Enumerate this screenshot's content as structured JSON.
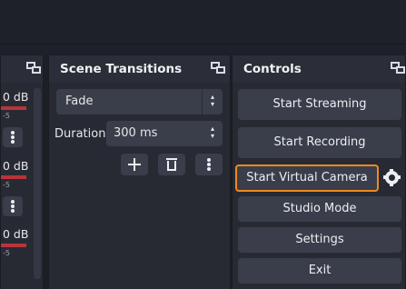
{
  "mixer": {
    "levels": [
      "0 dB",
      "0 dB",
      "0 dB"
    ],
    "tick_labels": [
      "-5",
      "-5",
      "-5"
    ]
  },
  "transitions": {
    "title": "Scene Transitions",
    "selected": "Fade",
    "duration_label": "Duration",
    "duration_value": "300 ms"
  },
  "controls": {
    "title": "Controls",
    "start_streaming": "Start Streaming",
    "start_recording": "Start Recording",
    "start_virtual_camera": "Start Virtual Camera",
    "studio_mode": "Studio Mode",
    "settings": "Settings",
    "exit": "Exit"
  },
  "colors": {
    "highlight": "#f08a1c",
    "meter": "#b8343a",
    "button": "#3a3e4a",
    "panel": "#272a33"
  }
}
